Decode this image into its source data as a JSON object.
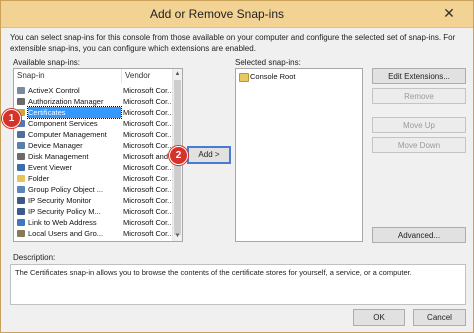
{
  "window": {
    "title": "Add or Remove Snap-ins",
    "close_glyph": "✕"
  },
  "intro_text": "You can select snap-ins for this console from those available on your computer and configure the selected set of snap-ins. For extensible snap-ins, you can configure which extensions are enabled.",
  "available": {
    "label": "Available snap-ins:",
    "columns": [
      "Snap-in",
      "Vendor"
    ],
    "rows": [
      {
        "name": "ActiveX Control",
        "vendor": "Microsoft Cor...",
        "icon": "activex-icon",
        "color": "#7a8aa3"
      },
      {
        "name": "Authorization Manager",
        "vendor": "Microsoft Cor...",
        "icon": "authorization-icon",
        "color": "#6a6a6a"
      },
      {
        "name": "Certificates",
        "vendor": "Microsoft Cor...",
        "icon": "certificate-icon",
        "color": "#c9a640",
        "selected": true
      },
      {
        "name": "Component Services",
        "vendor": "Microsoft Cor...",
        "icon": "component-icon",
        "color": "#4f79b8"
      },
      {
        "name": "Computer Management",
        "vendor": "Microsoft Cor...",
        "icon": "computer-management-icon",
        "color": "#4e6f9c"
      },
      {
        "name": "Device Manager",
        "vendor": "Microsoft Cor...",
        "icon": "device-manager-icon",
        "color": "#5a7fa8"
      },
      {
        "name": "Disk Management",
        "vendor": "Microsoft and...",
        "icon": "disk-icon",
        "color": "#6b6b6b"
      },
      {
        "name": "Event Viewer",
        "vendor": "Microsoft Cor...",
        "icon": "event-viewer-icon",
        "color": "#3d6eaa"
      },
      {
        "name": "Folder",
        "vendor": "Microsoft Cor...",
        "icon": "folder-icon",
        "color": "#e7c55a"
      },
      {
        "name": "Group Policy Object ...",
        "vendor": "Microsoft Cor...",
        "icon": "group-policy-icon",
        "color": "#5c86b8"
      },
      {
        "name": "IP Security Monitor",
        "vendor": "Microsoft Cor...",
        "icon": "ip-security-monitor-icon",
        "color": "#3a5a8a"
      },
      {
        "name": "IP Security Policy M...",
        "vendor": "Microsoft Cor...",
        "icon": "ip-security-policy-icon",
        "color": "#3a5a8a"
      },
      {
        "name": "Link to Web Address",
        "vendor": "Microsoft Cor...",
        "icon": "web-link-icon",
        "color": "#3d78c2"
      },
      {
        "name": "Local Users and Gro...",
        "vendor": "Microsoft Cor...",
        "icon": "users-icon",
        "color": "#8a7a5a"
      }
    ]
  },
  "selected": {
    "label": "Selected snap-ins:",
    "items": [
      {
        "name": "Console Root",
        "icon": "console-root-icon"
      }
    ]
  },
  "buttons": {
    "add": "Add >",
    "edit_extensions": "Edit Extensions...",
    "remove": "Remove",
    "move_up": "Move Up",
    "move_down": "Move Down",
    "advanced": "Advanced...",
    "ok": "OK",
    "cancel": "Cancel"
  },
  "description": {
    "label": "Description:",
    "text": "The Certificates snap-in allows you to browse the contents of the certificate stores for yourself, a service, or a computer."
  },
  "badges": [
    "1",
    "2"
  ],
  "colors": {
    "title_bar": "#f2d394",
    "selection": "#3399ff",
    "callout_badge": "#d4332a",
    "callout_border": "#4a7bd1"
  }
}
